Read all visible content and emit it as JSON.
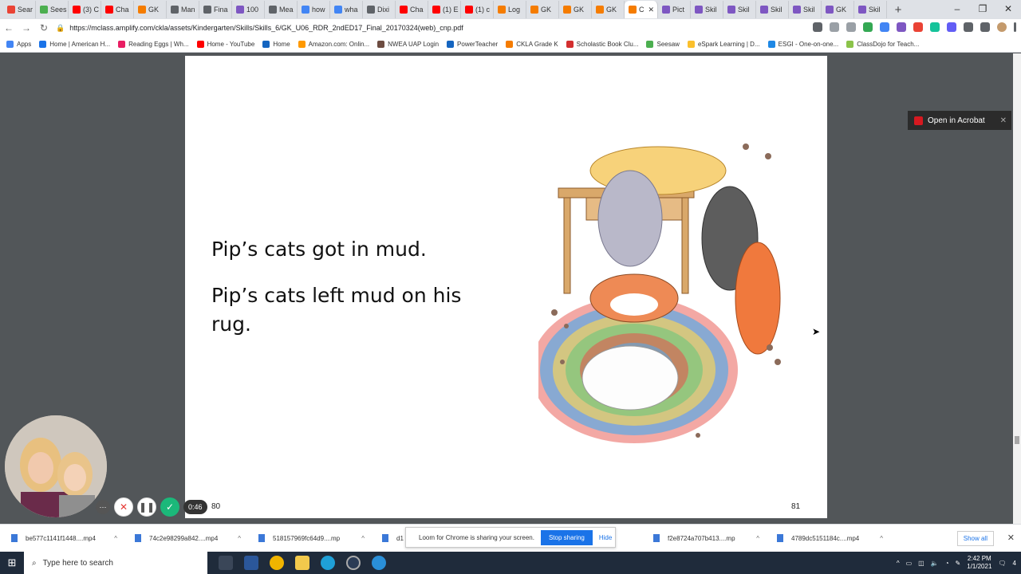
{
  "tabs": [
    {
      "label": "Sear",
      "color": "#ea4335"
    },
    {
      "label": "Sees",
      "color": "#4caf50"
    },
    {
      "label": "(3) C",
      "color": "#ff0000"
    },
    {
      "label": "Cha",
      "color": "#ff0000"
    },
    {
      "label": "GK",
      "color": "#f57c00"
    },
    {
      "label": "Man",
      "color": "#5f6368"
    },
    {
      "label": "Fina",
      "color": "#5f6368"
    },
    {
      "label": "100",
      "color": "#7e57c2"
    },
    {
      "label": "Mea",
      "color": "#5f6368"
    },
    {
      "label": "how",
      "color": "#4285f4"
    },
    {
      "label": "wha",
      "color": "#4285f4"
    },
    {
      "label": "Dixi",
      "color": "#5f6368"
    },
    {
      "label": "Cha",
      "color": "#ff0000"
    },
    {
      "label": "(1) E",
      "color": "#ff0000"
    },
    {
      "label": "(1) c",
      "color": "#ff0000"
    },
    {
      "label": "Log",
      "color": "#f57c00"
    },
    {
      "label": "GK",
      "color": "#f57c00"
    },
    {
      "label": "GK",
      "color": "#f57c00"
    },
    {
      "label": "GK",
      "color": "#f57c00"
    },
    {
      "label": "C",
      "color": "#f57c00",
      "active": true
    },
    {
      "label": "Pict",
      "color": "#7e57c2"
    },
    {
      "label": "Skil",
      "color": "#7e57c2"
    },
    {
      "label": "Skil",
      "color": "#7e57c2"
    },
    {
      "label": "Skil",
      "color": "#7e57c2"
    },
    {
      "label": "Skil",
      "color": "#7e57c2"
    },
    {
      "label": "GK",
      "color": "#7e57c2"
    },
    {
      "label": "Skil",
      "color": "#7e57c2"
    }
  ],
  "address": {
    "url": "https://mclass.amplify.com/ckla/assets/Kindergarten/Skills/Skills_6/GK_U06_RDR_2ndED17_Final_20170324(web)_cnp.pdf"
  },
  "bookmarks": [
    {
      "label": "Apps",
      "color": "#4285f4"
    },
    {
      "label": "Home | American H...",
      "color": "#1a73e8"
    },
    {
      "label": "Reading Eggs | Wh...",
      "color": "#e91e63"
    },
    {
      "label": "Home - YouTube",
      "color": "#ff0000"
    },
    {
      "label": "Home",
      "color": "#1565c0"
    },
    {
      "label": "Amazon.com: Onlin...",
      "color": "#ff9900"
    },
    {
      "label": "NWEA UAP Login",
      "color": "#6d4c41"
    },
    {
      "label": "PowerTeacher",
      "color": "#1565c0"
    },
    {
      "label": "CKLA Grade K",
      "color": "#f57c00"
    },
    {
      "label": "Scholastic Book Clu...",
      "color": "#d32f2f"
    },
    {
      "label": "Seesaw",
      "color": "#4caf50"
    },
    {
      "label": "eSpark Learning | D...",
      "color": "#fbc02d"
    },
    {
      "label": "ESGI - One-on-one...",
      "color": "#1e88e5"
    },
    {
      "label": "ClassDojo for Teach...",
      "color": "#8bc34a"
    }
  ],
  "pdf": {
    "line1": "Pip’s cats got in mud.",
    "line2": "Pip’s cats left mud on his rug.",
    "page_left": "80",
    "page_right": "81"
  },
  "acrobat": {
    "label": "Open in Acrobat"
  },
  "recorder": {
    "timer": "0:46"
  },
  "downloads": [
    {
      "label": "be577c1141f1448....mp4"
    },
    {
      "label": "74c2e98299a842....mp4"
    },
    {
      "label": "518157969fc64d9....mp"
    },
    {
      "label": "d1"
    },
    {
      "label": "f2e8724a707b413....mp"
    },
    {
      "label": "4789dc5151184c....mp4"
    }
  ],
  "loom": {
    "message": "Loom for Chrome is sharing your screen.",
    "stop": "Stop sharing",
    "hide": "Hide"
  },
  "show_all": "Show all",
  "taskbar": {
    "search_placeholder": "Type here to search",
    "time": "2:42 PM",
    "date": "1/1/2021",
    "notif_count": "4"
  }
}
